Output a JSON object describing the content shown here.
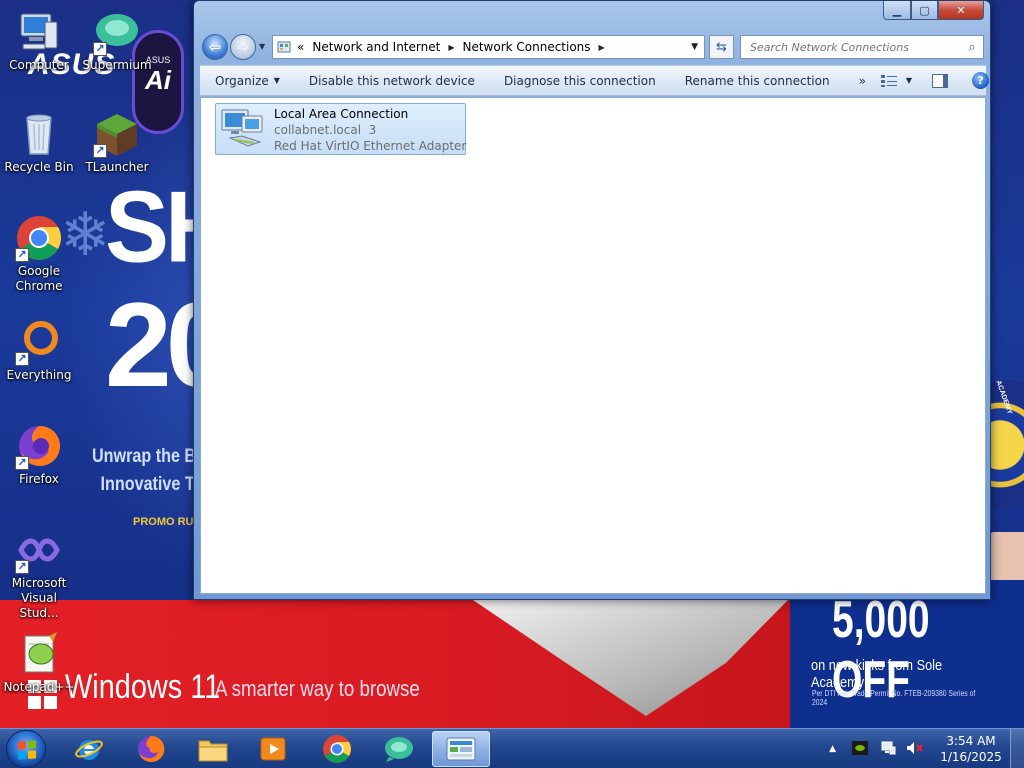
{
  "wallpaper": {
    "brand": "ASUS",
    "ai_badge_small": "ASUS",
    "ai_badge_big": "Ai",
    "headline_1": "SH",
    "headline_2": "20",
    "tagline_1": "Unwrap the Bes",
    "tagline_2": "Innovative Tec",
    "promo": "PROMO RUNS",
    "windows_brand": "Windows 11",
    "windows_tagline": "A smarter way to browse",
    "offer_big": "5,000 OFF",
    "offer_line": "on new kicks from Sole Academy!",
    "permit_line": "Per DTI Fair Trade Permit No. FTEB-209380 Series of 2024",
    "academy": "ACADEMY"
  },
  "desktop": {
    "icons": [
      {
        "label": "Computer",
        "icon": "computer-icon"
      },
      {
        "label": "Supermium",
        "icon": "supermium-icon"
      },
      {
        "label": "Recycle Bin",
        "icon": "recycle-bin-icon"
      },
      {
        "label": "TLauncher",
        "icon": "tlauncher-icon"
      },
      {
        "label": "Google Chrome",
        "icon": "chrome-icon"
      },
      {
        "label": "Everything",
        "icon": "everything-icon"
      },
      {
        "label": "Firefox",
        "icon": "firefox-icon"
      },
      {
        "label": "Microsoft Visual Stud...",
        "icon": "visual-studio-icon"
      },
      {
        "label": "Notepad++",
        "icon": "notepad-plus-plus-icon"
      }
    ]
  },
  "window": {
    "title_buttons": {
      "minimize": "minimize",
      "maximize": "maximize",
      "close": "close"
    },
    "address": {
      "overflow": "«",
      "crumbs": [
        "Network and Internet",
        "Network Connections"
      ]
    },
    "search": {
      "placeholder": "Search Network Connections",
      "value": ""
    },
    "toolbar": {
      "organize": "Organize",
      "disable": "Disable this network device",
      "diagnose": "Diagnose this connection",
      "rename": "Rename this connection",
      "more": "»"
    },
    "connections": [
      {
        "name": "Local Area Connection",
        "network": "collabnet.local  3",
        "adapter": "Red Hat VirtIO Ethernet Adapter",
        "selected": true
      }
    ]
  },
  "taskbar": {
    "pinned": [
      "internet-explorer-icon",
      "firefox-icon",
      "file-explorer-icon",
      "media-player-icon",
      "chrome-icon",
      "supermium-icon",
      "network-connections-icon"
    ],
    "active_app": "network-connections-icon",
    "clock": {
      "time": "3:54 AM",
      "date": "1/16/2025"
    },
    "tray_icons": [
      "nvidia-icon",
      "network-icon",
      "volume-muted-icon"
    ]
  }
}
